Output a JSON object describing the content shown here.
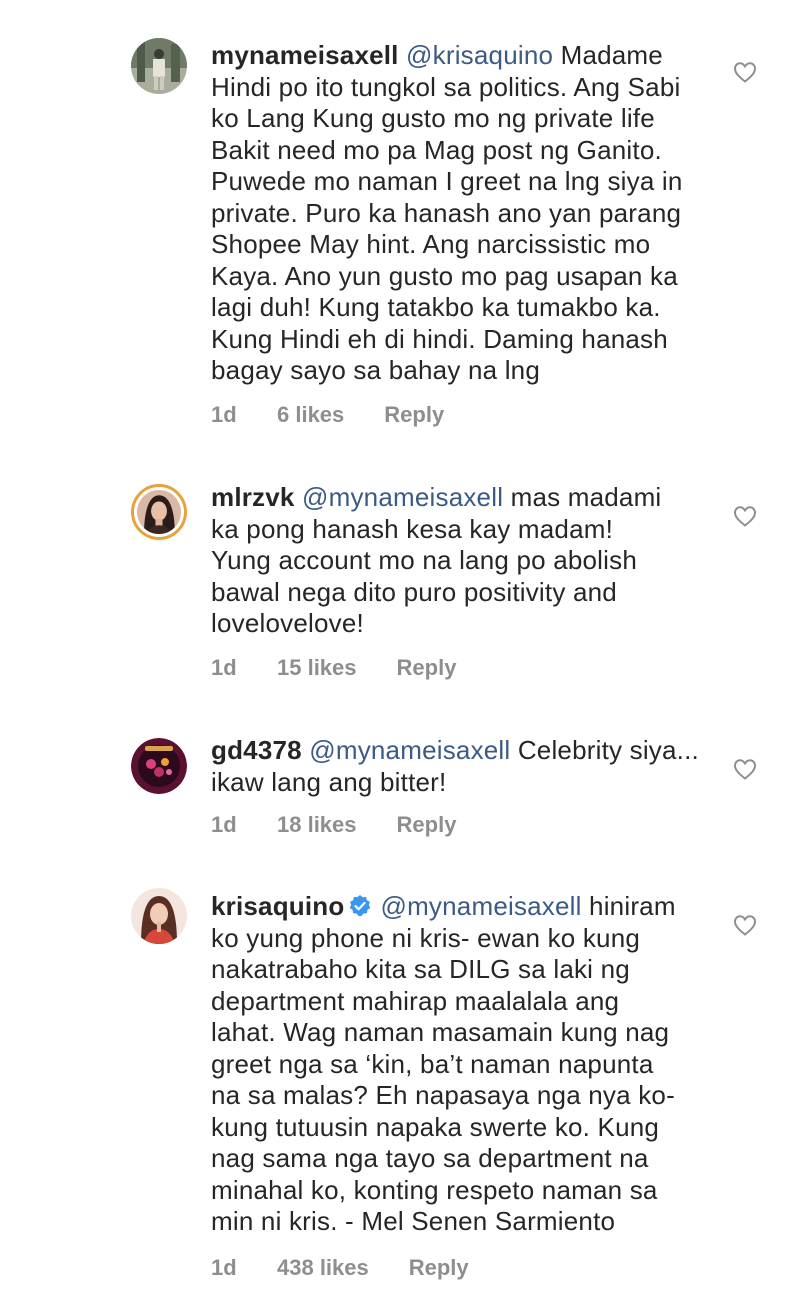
{
  "comments": [
    {
      "username": "mynameisaxell",
      "mention": "@krisaquino",
      "first_line_rest": " Madame",
      "lines": [
        "Hindi po ito tungkol sa politics. Ang Sabi",
        "ko Lang Kung gusto mo ng private life",
        "Bakit need mo pa Mag post ng Ganito.",
        "Puwede mo naman I greet na lng siya in",
        "private. Puro ka hanash ano yan parang",
        "Shopee May hint. Ang narcissistic mo",
        "Kaya. Ano yun gusto mo pag usapan ka",
        "lagi duh! Kung tatakbo ka tumakbo ka.",
        "Kung Hindi eh di hindi. Daming hanash",
        "bagay sayo sa bahay na lng"
      ],
      "time": "1d",
      "likes": "6 likes",
      "reply": "Reply"
    },
    {
      "username": "mlrzvk",
      "mention": "@mynameisaxell",
      "first_line_rest": " mas madami",
      "lines": [
        "ka pong hanash kesa kay madam!",
        "Yung account mo na lang po abolish",
        "bawal nega dito puro positivity and",
        "lovelovelove!"
      ],
      "time": "1d",
      "likes": "15 likes",
      "reply": "Reply"
    },
    {
      "username": "gd4378",
      "mention": "@mynameisaxell",
      "first_line_rest": " Celebrity siya...",
      "lines": [
        "ikaw lang ang bitter!"
      ],
      "time": "1d",
      "likes": "18 likes",
      "reply": "Reply"
    },
    {
      "username": "krisaquino",
      "mention": "@mynameisaxell",
      "first_line_rest": " hiniram",
      "lines": [
        "ko yung phone ni kris- ewan ko kung",
        "nakatrabaho kita sa DILG sa laki ng",
        "department mahirap maalalala ang",
        "lahat. Wag naman masamain kung nag",
        "greet nga sa ‘kin, ba’t naman napunta",
        "na sa malas? Eh napasaya nga nya ko-",
        "kung tutuusin napaka swerte ko. Kung",
        "nag sama nga tayo sa department na",
        "minahal ko, konting respeto naman sa",
        "min ni kris. - Mel Senen Sarmiento"
      ],
      "time": "1d",
      "likes": "438 likes",
      "reply": "Reply"
    }
  ],
  "icons": {
    "like": "heart-outline-icon",
    "verified": "verified-badge-icon"
  },
  "colors": {
    "text": "#262626",
    "mention": "#3b5a85",
    "meta": "#8e8e8e",
    "verified": "#3897f0",
    "story_ring": "#e8a23c"
  }
}
